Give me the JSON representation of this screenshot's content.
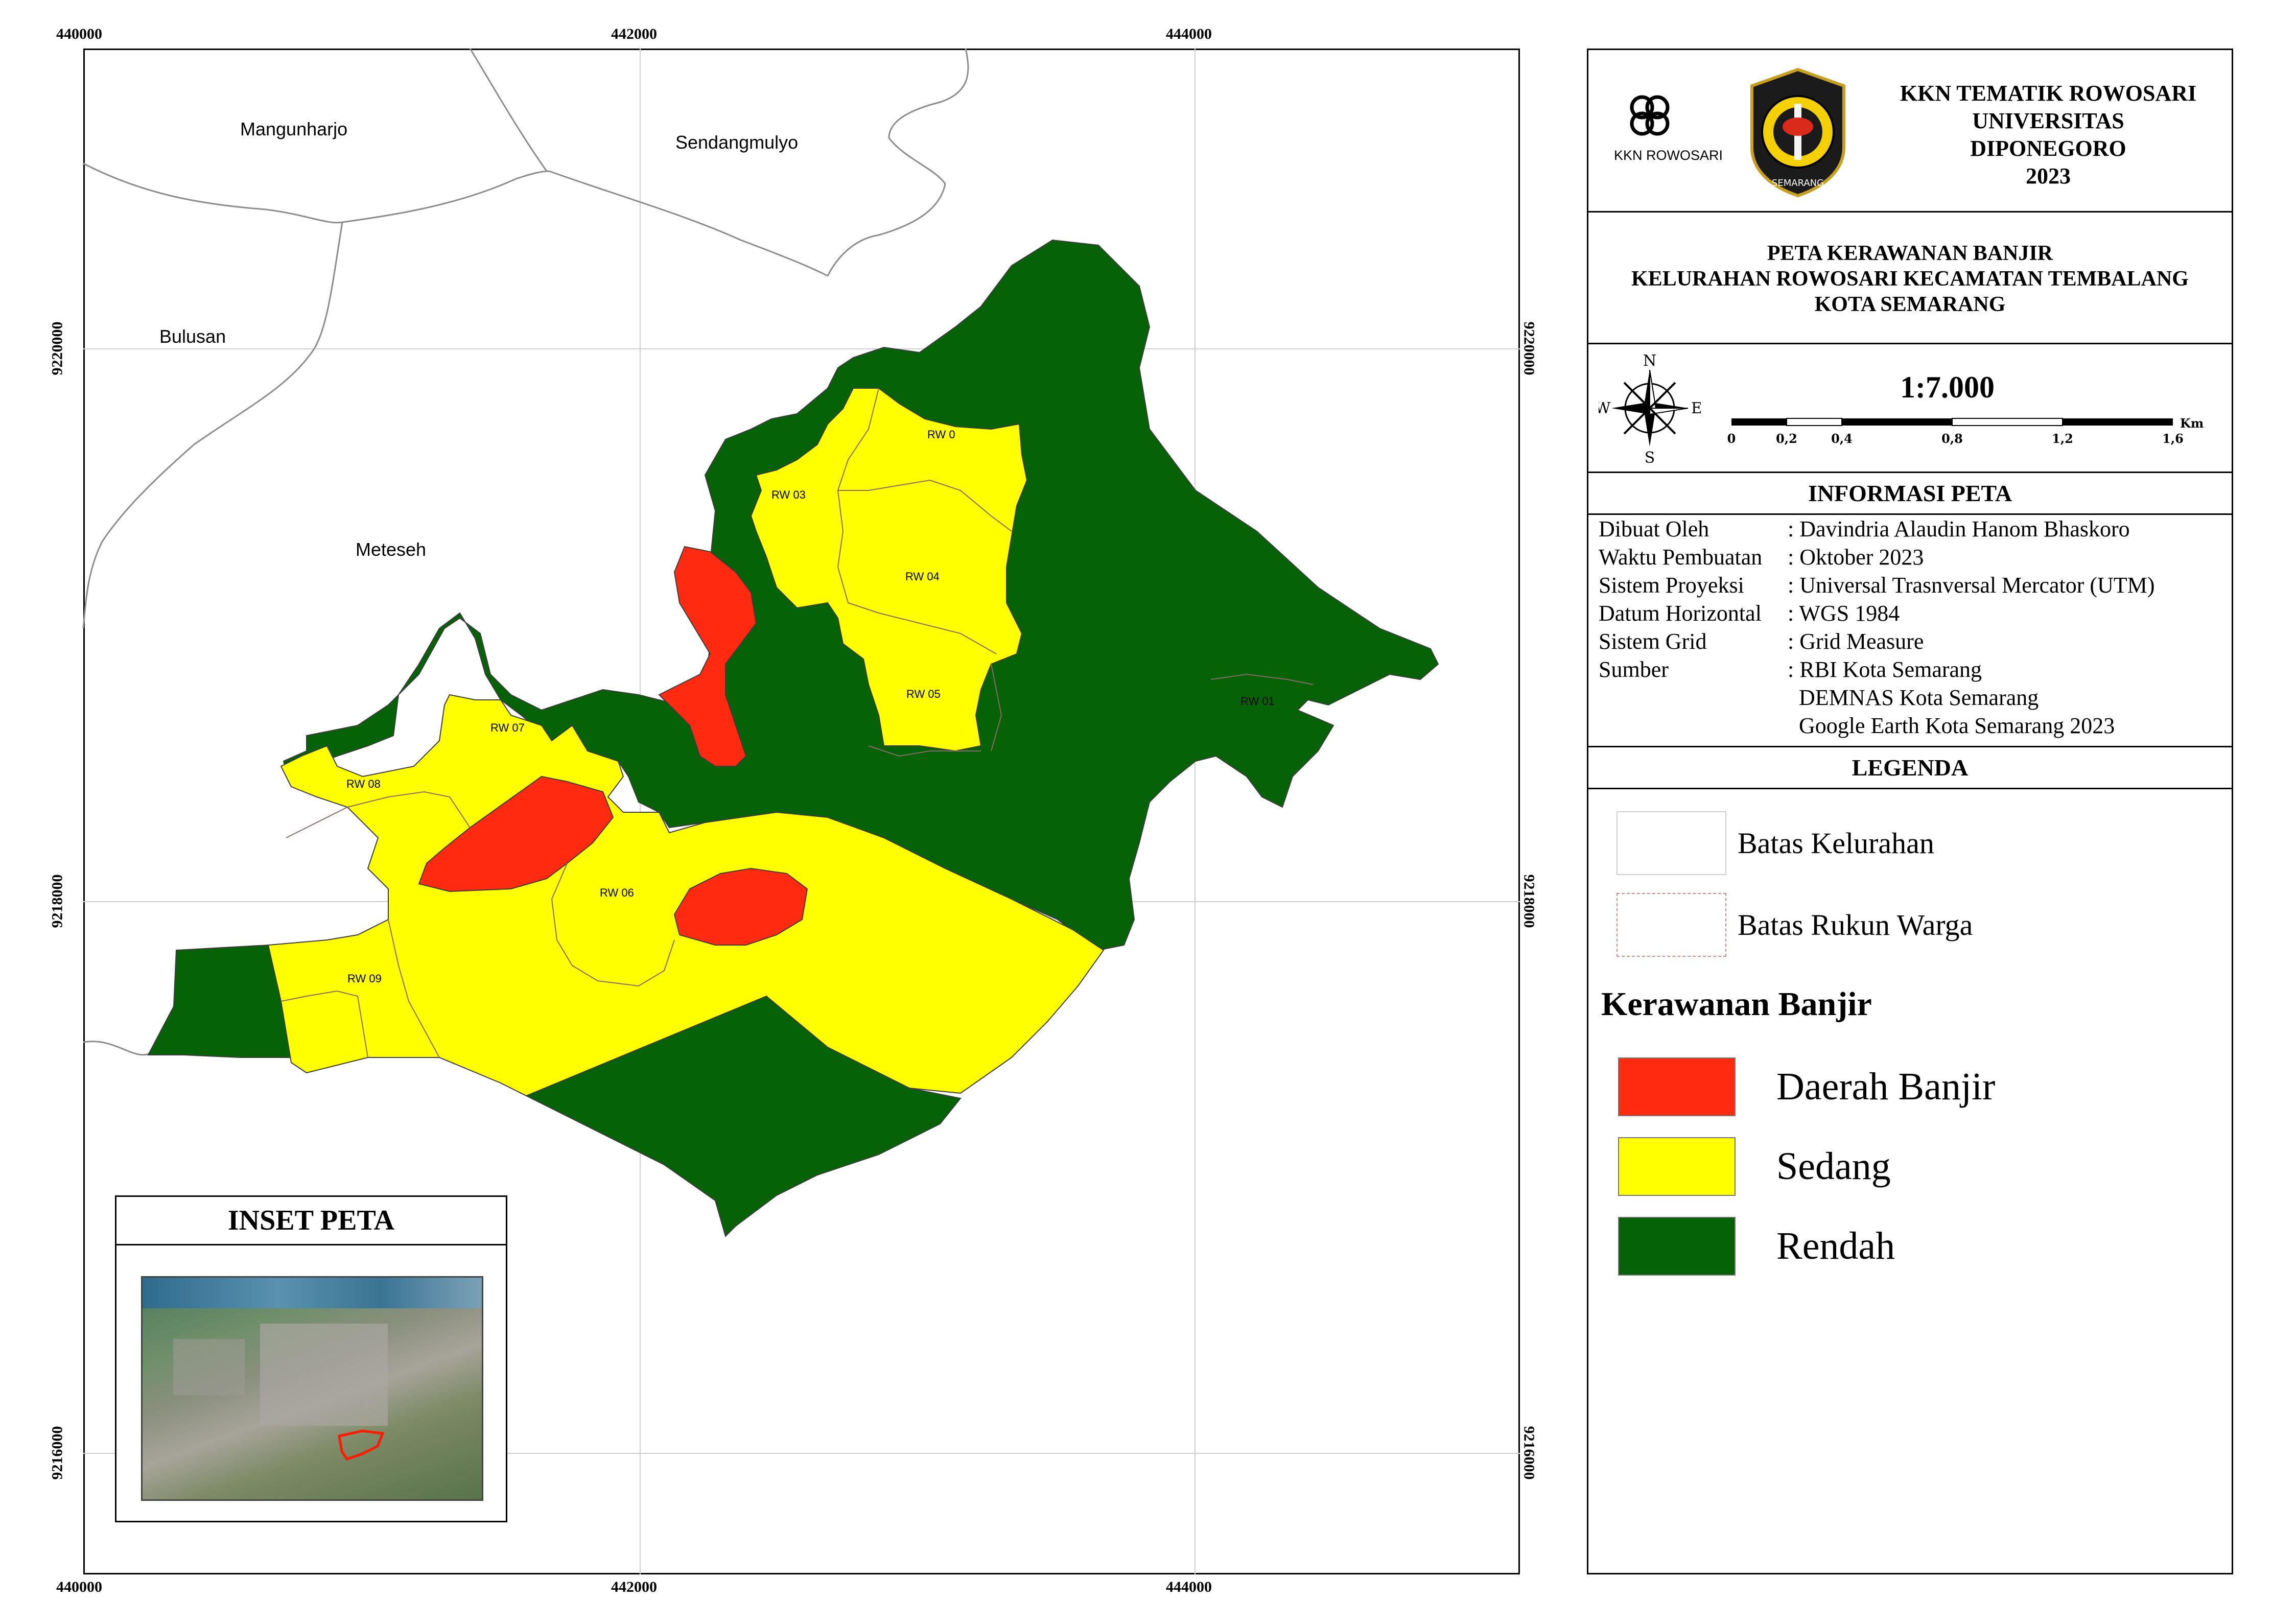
{
  "map": {
    "x_ticks": [
      "440000",
      "442000",
      "444000"
    ],
    "y_ticks": [
      "9220000",
      "9218000",
      "9216000"
    ],
    "places": {
      "mangunharjo": "Mangunharjo",
      "sendangmulyo": "Sendangmulyo",
      "bulusan": "Bulusan",
      "meteseh": "Meteseh"
    },
    "rw_labels": {
      "rw01": "RW 01",
      "rw02": "RW 0",
      "rw03": "RW 03",
      "rw04": "RW 04",
      "rw05": "RW 05",
      "rw06": "RW 06",
      "rw07": "RW 07",
      "rw08": "RW 08",
      "rw09": "RW 09"
    },
    "colors": {
      "flood": "#ff2a0f",
      "medium": "#ffff00",
      "low": "#066206",
      "boundary": "#9a9a9a"
    }
  },
  "inset": {
    "title": "INSET PETA"
  },
  "header": {
    "logo_text": "KKN ROWOSARI",
    "seal_top": "UNIVERSITAS DIPONEGORO",
    "seal_bottom": "SEMARANG",
    "org_line1": "KKN TEMATIK ROWOSARI",
    "org_line2": "UNIVERSITAS",
    "org_line3": "DIPONEGORO",
    "org_line4": "2023"
  },
  "title": {
    "line1": "PETA KERAWANAN BANJIR",
    "line2": "KELURAHAN ROWOSARI KECAMATAN TEMBALANG",
    "line3": "KOTA SEMARANG"
  },
  "scale": {
    "ratio": "1:7.000",
    "unit": "Km",
    "ticks": [
      "0",
      "0,2",
      "0,4",
      "0,8",
      "1,2",
      "1,6"
    ],
    "compass": {
      "n": "N",
      "s": "S",
      "e": "E",
      "w": "W"
    }
  },
  "info": {
    "heading": "INFORMASI PETA",
    "rows": [
      {
        "k": "Dibuat Oleh",
        "v": ": Davindria Alaudin Hanom Bhaskoro"
      },
      {
        "k": "Waktu Pembuatan",
        "v": ": Oktober 2023"
      },
      {
        "k": "Sistem Proyeksi",
        "v": ": Universal Trasnversal Mercator (UTM)"
      },
      {
        "k": "Datum Horizontal",
        "v": ": WGS 1984"
      },
      {
        "k": "Sistem Grid",
        "v": ": Grid Measure"
      },
      {
        "k": "Sumber",
        "v": ": RBI Kota Semarang"
      },
      {
        "k": "",
        "v": "  DEMNAS Kota Semarang"
      },
      {
        "k": "",
        "v": "  Google Earth Kota Semarang 2023"
      }
    ]
  },
  "legend": {
    "heading": "LEGENDA",
    "batas_kelurahan": "Batas Kelurahan",
    "batas_rw": "Batas Rukun Warga",
    "kerawanan_heading": "Kerawanan Banjir",
    "daerah_banjir": "Daerah Banjir",
    "sedang": "Sedang",
    "rendah": "Rendah"
  }
}
